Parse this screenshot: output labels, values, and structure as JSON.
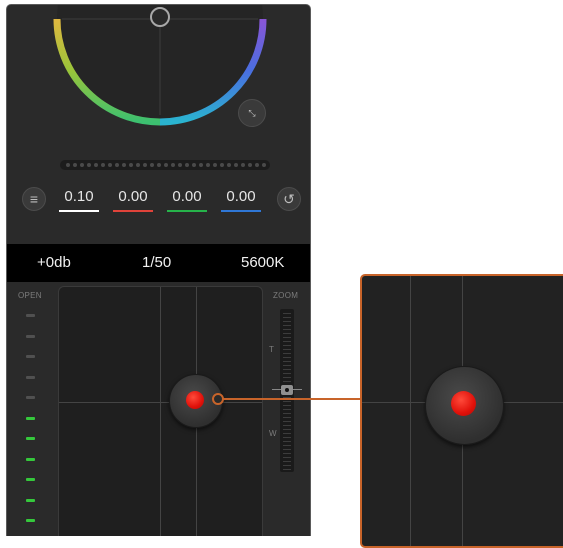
{
  "color_wheel": {
    "values": [
      {
        "label": "0.10",
        "color": "#ffffff"
      },
      {
        "label": "0.00",
        "color": "#e0433a"
      },
      {
        "label": "0.00",
        "color": "#26b34a"
      },
      {
        "label": "0.00",
        "color": "#2f77d6"
      }
    ]
  },
  "camera_bar": {
    "gain": "+0db",
    "shutter": "1/50",
    "white_balance": "5600K"
  },
  "iris": {
    "label": "OPEN",
    "leds_total": 11,
    "leds_lit": 6,
    "led_color": "#35c83c"
  },
  "zoom": {
    "label": "ZOOM",
    "tele_label": "T",
    "wide_label": "W"
  },
  "icons": {
    "menu": "menu-icon",
    "reset": "reset-icon",
    "expand": "expand-icon"
  },
  "accent_color": "#c8642a",
  "joystick_color": "#e0110a"
}
